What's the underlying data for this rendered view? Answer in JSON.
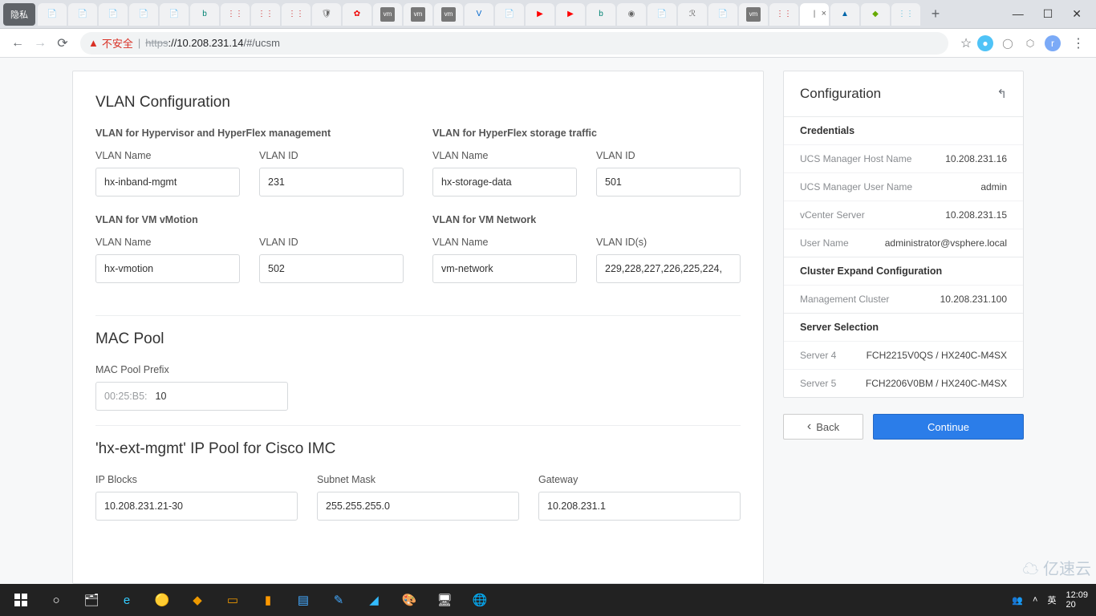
{
  "browser": {
    "incognito_label": "隐私",
    "url_warn": "不安全",
    "url_proto": "https",
    "url_host": "://10.208.231.14",
    "url_path": "/#/ucsm",
    "tabs_count": 31
  },
  "page": {
    "vlan": {
      "title": "VLAN Configuration",
      "hyper": {
        "heading": "VLAN for Hypervisor and HyperFlex management",
        "name_label": "VLAN Name",
        "name_value": "hx-inband-mgmt",
        "id_label": "VLAN ID",
        "id_value": "231"
      },
      "storage": {
        "heading": "VLAN for HyperFlex storage traffic",
        "name_label": "VLAN Name",
        "name_value": "hx-storage-data",
        "id_label": "VLAN ID",
        "id_value": "501"
      },
      "vmotion": {
        "heading": "VLAN for VM vMotion",
        "name_label": "VLAN Name",
        "name_value": "hx-vmotion",
        "id_label": "VLAN ID",
        "id_value": "502"
      },
      "vmnet": {
        "heading": "VLAN for VM Network",
        "name_label": "VLAN Name",
        "name_value": "vm-network",
        "id_label": "VLAN ID(s)",
        "id_value": "229,228,227,226,225,224,"
      }
    },
    "mac": {
      "title": "MAC Pool",
      "label": "MAC Pool Prefix",
      "prefix": "00:25:B5:",
      "value": "10"
    },
    "ippool": {
      "title": "'hx-ext-mgmt' IP Pool for Cisco IMC",
      "blocks_label": "IP Blocks",
      "blocks_value": "10.208.231.21-30",
      "mask_label": "Subnet Mask",
      "mask_value": "255.255.255.0",
      "gw_label": "Gateway",
      "gw_value": "10.208.231.1"
    }
  },
  "side": {
    "title": "Configuration",
    "creds": {
      "heading": "Credentials",
      "items": [
        {
          "k": "UCS Manager Host Name",
          "v": "10.208.231.16"
        },
        {
          "k": "UCS Manager User Name",
          "v": "admin"
        },
        {
          "k": "vCenter Server",
          "v": "10.208.231.15"
        },
        {
          "k": "User Name",
          "v": "administrator@vsphere.local"
        }
      ]
    },
    "cluster": {
      "heading": "Cluster Expand Configuration",
      "items": [
        {
          "k": "Management Cluster",
          "v": "10.208.231.100"
        }
      ]
    },
    "servers": {
      "heading": "Server Selection",
      "items": [
        {
          "k": "Server 4",
          "v": "FCH2215V0QS / HX240C-M4SX"
        },
        {
          "k": "Server 5",
          "v": "FCH2206V0BM / HX240C-M4SX"
        }
      ]
    },
    "back": "Back",
    "continue": "Continue"
  },
  "tray": {
    "lang": "英",
    "time": "12:09",
    "date": "20"
  },
  "watermark": "亿速云"
}
